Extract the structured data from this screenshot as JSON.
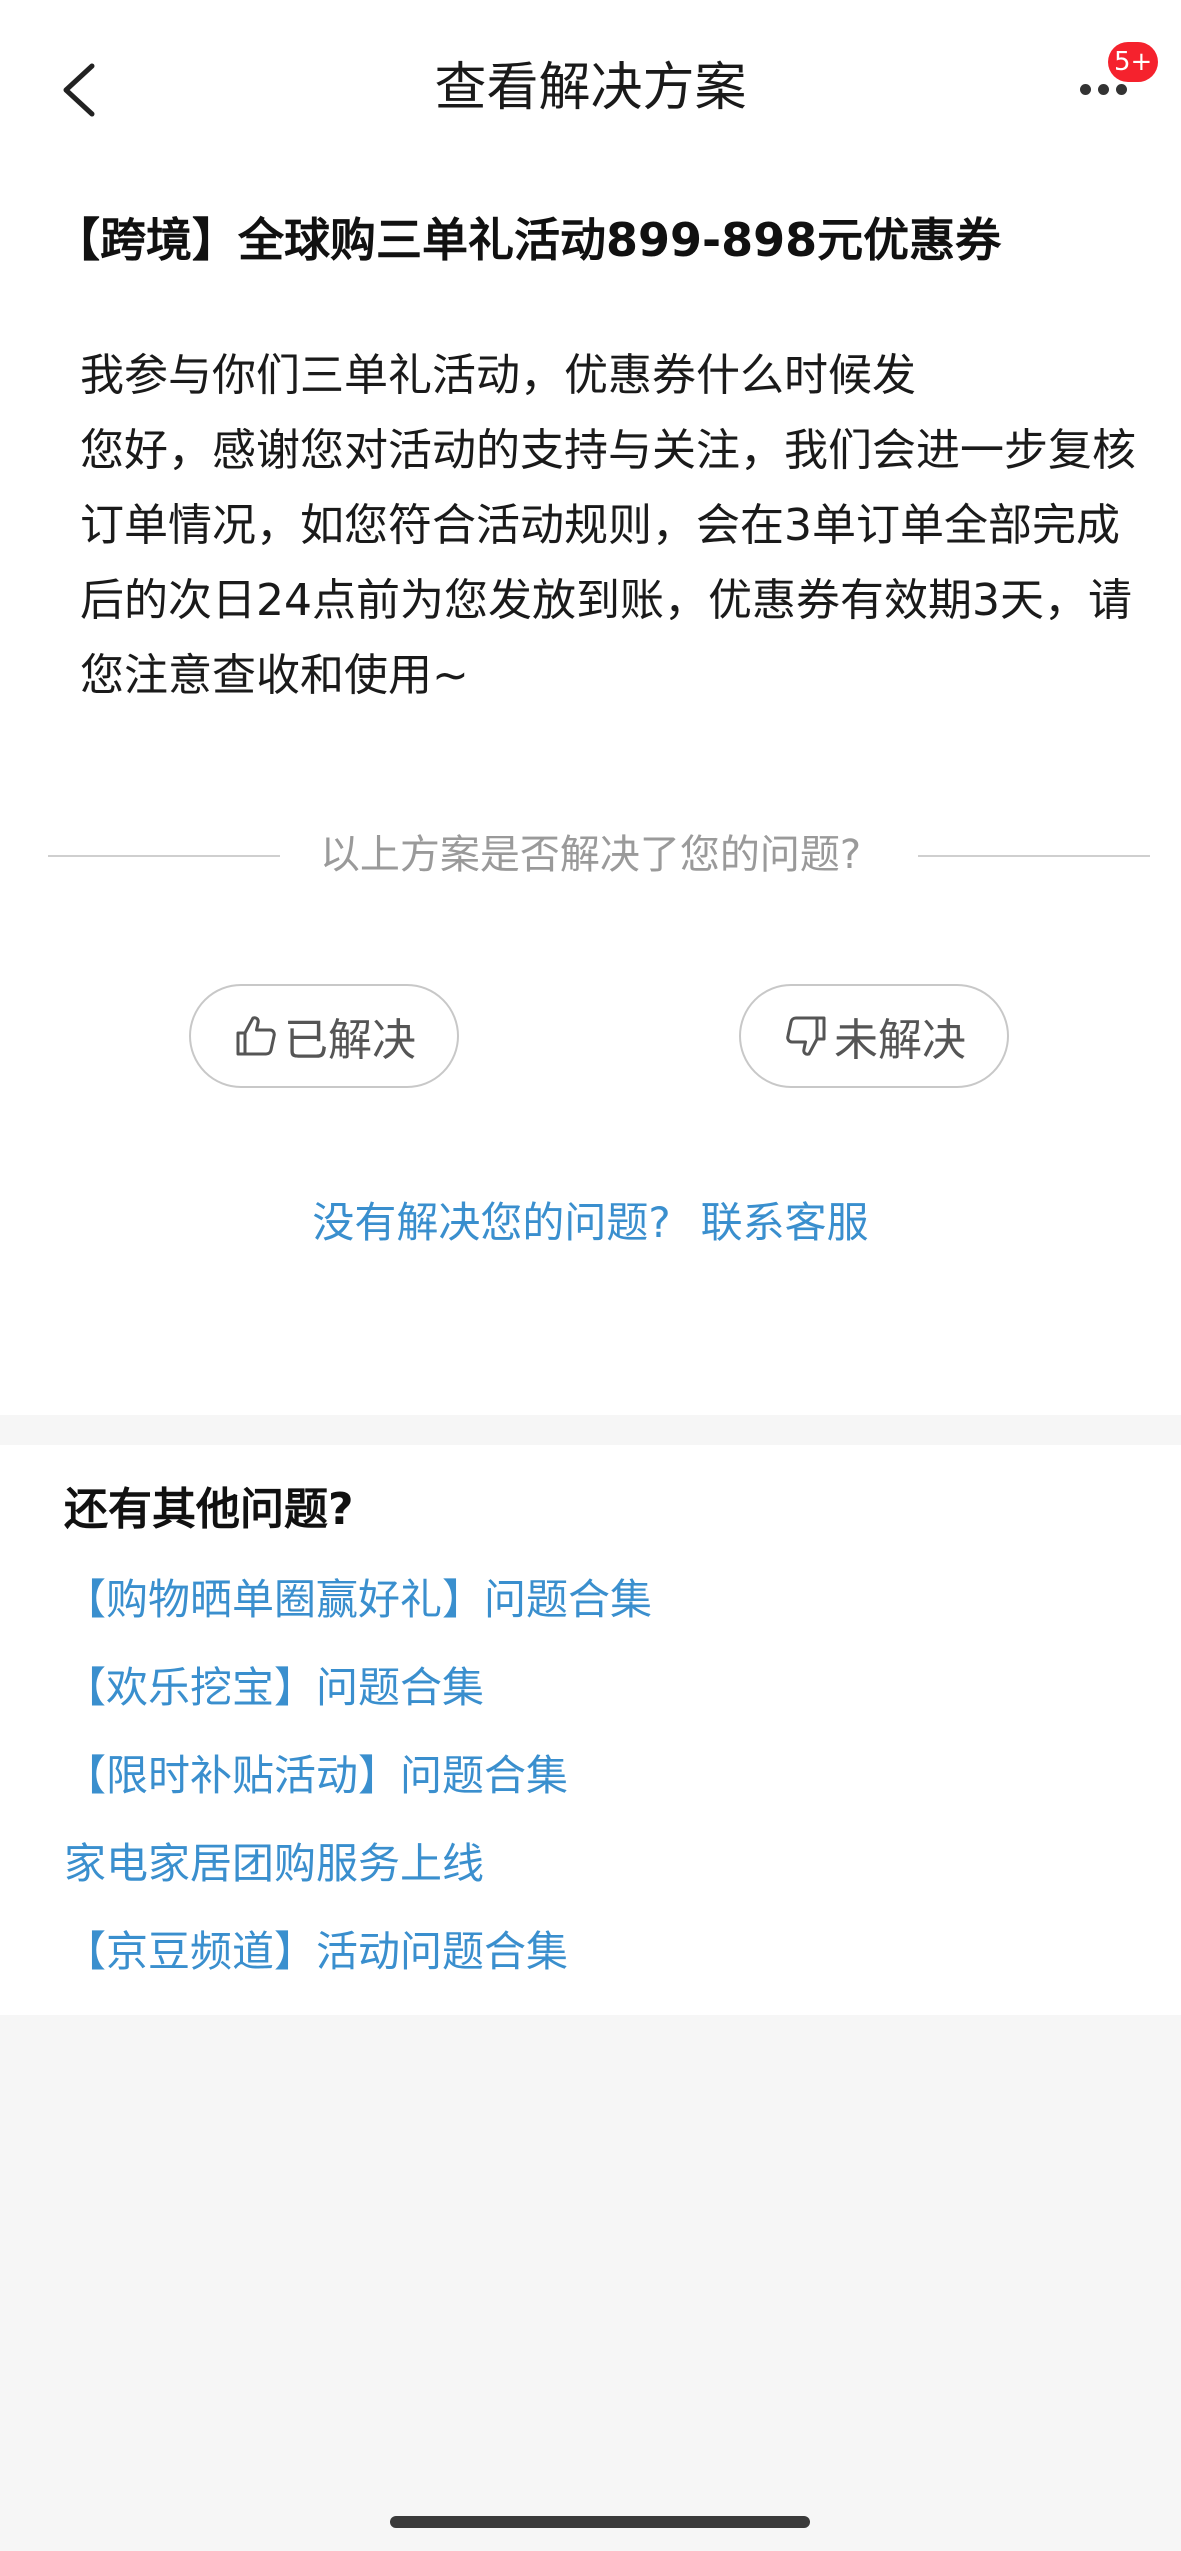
{
  "nav": {
    "title": "查看解决方案",
    "badge": "5+",
    "back_icon": "chevron-left-icon",
    "more_icon": "more-dots-icon"
  },
  "question": {
    "title": "【跨境】全球购三单礼活动899-898元优惠券"
  },
  "answer": {
    "user_question": "我参与你们三单礼活动，优惠券什么时候发",
    "reply": "您好，感谢您对活动的支持与关注，我们会进一步复核订单情况，如您符合活动规则，会在3单订单全部完成后的次日24点前为您发放到账，优惠券有效期3天，请您注意查收和使用~"
  },
  "feedback": {
    "prompt": "以上方案是否解决了您的问题?",
    "solved_label": "已解决",
    "unsolved_label": "未解决",
    "solved_icon": "thumbs-up-icon",
    "unsolved_icon": "thumbs-down-icon"
  },
  "contact": {
    "question_text": "没有解决您的问题?",
    "link_text": "联系客服"
  },
  "more_questions": {
    "heading": "还有其他问题?",
    "links": [
      "【购物晒单圈赢好礼】问题合集",
      "【欢乐挖宝】问题合集",
      "【限时补贴活动】问题合集",
      "家电家居团购服务上线",
      "【京豆频道】活动问题合集"
    ]
  },
  "colors": {
    "link": "#3a8fce",
    "badge": "#f5222d",
    "muted": "#9a9a9a",
    "page_background": "#f6f6f6"
  }
}
